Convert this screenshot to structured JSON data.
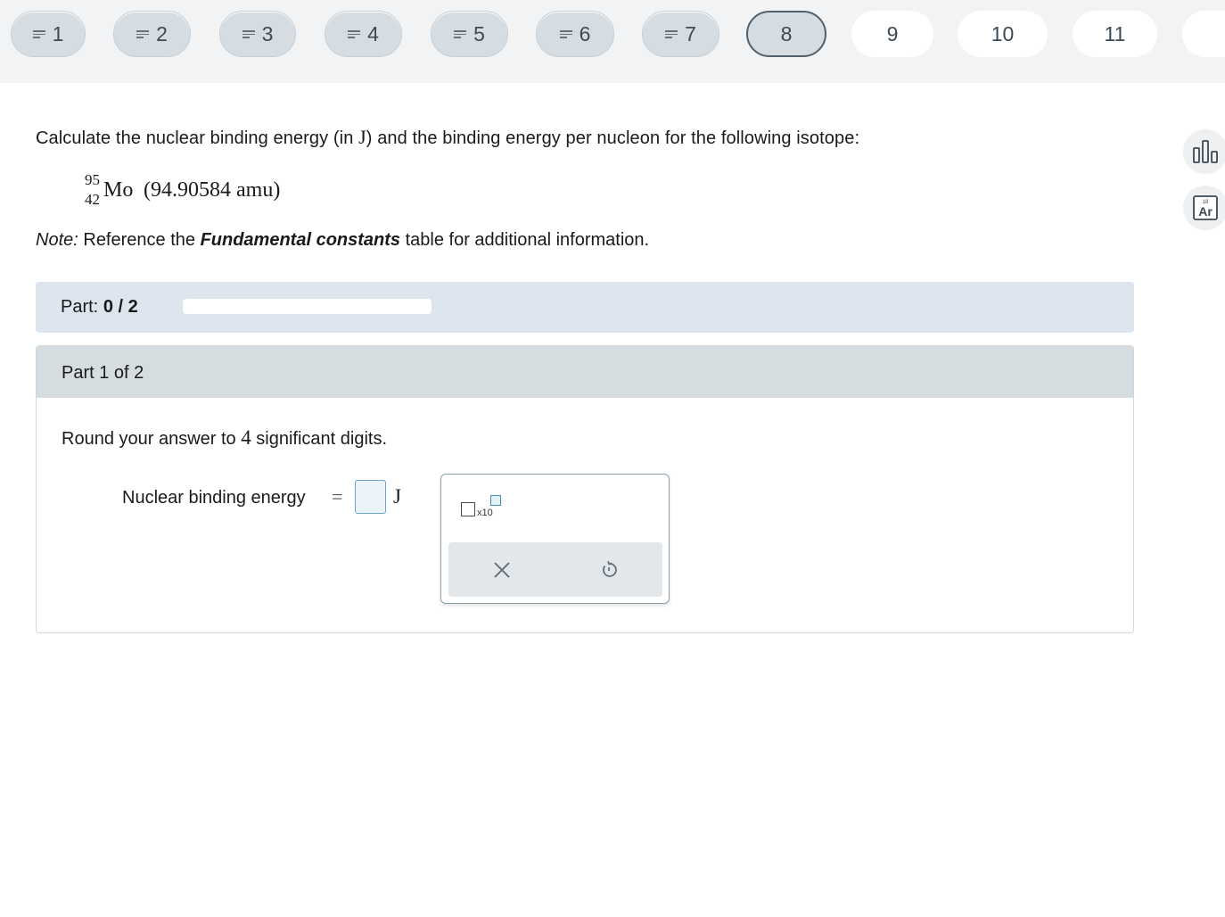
{
  "nav": {
    "questions": [
      {
        "label": "1",
        "state": "answered"
      },
      {
        "label": "2",
        "state": "answered"
      },
      {
        "label": "3",
        "state": "answered"
      },
      {
        "label": "4",
        "state": "answered"
      },
      {
        "label": "5",
        "state": "answered"
      },
      {
        "label": "6",
        "state": "answered"
      },
      {
        "label": "7",
        "state": "answered"
      },
      {
        "label": "8",
        "state": "current"
      },
      {
        "label": "9",
        "state": "unanswered"
      },
      {
        "label": "10",
        "state": "unanswered"
      },
      {
        "label": "11",
        "state": "unanswered"
      }
    ]
  },
  "problem": {
    "prompt_before": "Calculate the nuclear binding energy (in ",
    "prompt_unit": "J",
    "prompt_after": ") and the binding energy per nucleon for the following isotope:",
    "isotope": {
      "mass_number": "95",
      "atomic_number": "42",
      "symbol": "Mo",
      "atomic_mass": "(94.90584 amu)"
    },
    "note_label": "Note:",
    "note_before": " Reference the ",
    "note_link": "Fundamental constants",
    "note_after": " table for additional information."
  },
  "progress": {
    "label": "Part:",
    "value_text": "0 / 2",
    "fraction": 0
  },
  "part": {
    "title": "Part 1 of 2",
    "instruction_before": "Round your answer to ",
    "instruction_number": "4",
    "instruction_after": " significant digits.",
    "field_label": "Nuclear binding energy",
    "equals": "=",
    "answer_value": "",
    "unit": "J"
  },
  "palette": {
    "sci_notation_text": "x10",
    "icons": [
      "scientific-notation-icon",
      "clear-x-icon",
      "undo-icon"
    ]
  },
  "sidebar": {
    "icons": [
      "bar-chart-icon",
      "periodic-table-icon"
    ],
    "periodic_number": "18",
    "periodic_symbol": "Ar"
  },
  "colors": {
    "nav_answered_bg": "#d6dde2",
    "nav_current_border": "#52606b",
    "part_bar_bg": "#dde6ee",
    "part_head_bg": "#d6dde1",
    "answer_border": "#6fa3c2"
  }
}
